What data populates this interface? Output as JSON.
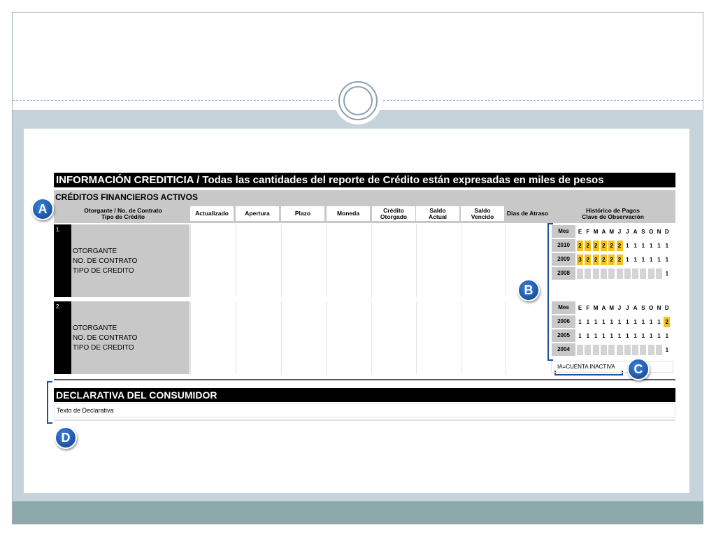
{
  "report": {
    "title": "INFORMACIÓN CREDITICIA / Todas las cantidades del reporte de Crédito están expresadas en miles de pesos",
    "section": "CRÉDITOS FINANCIEROS ACTIVOS",
    "headers": {
      "otorgante": "Otorgante / No. de Contrato\nTipo de Crédito",
      "actualizado": "Actualizado",
      "apertura": "Apertura",
      "plazo": "Plazo",
      "moneda": "Moneda",
      "credito_otorgado": "Crédito\nOtorgado",
      "saldo_actual": "Saldo\nActual",
      "saldo_vencido": "Saldo\nVencido",
      "dias_atraso": "Dias de Atraso",
      "historico": "Histórico de Pagos\nClave de Observación"
    },
    "records": [
      {
        "number": "1.",
        "lines": [
          "OTORGANTE",
          "NO. DE CONTRATO",
          "TIPO DE CREDITO"
        ],
        "history": [
          {
            "year": "Mes",
            "cells": [
              "E",
              "F",
              "M",
              "A",
              "M",
              "J",
              "J",
              "A",
              "S",
              "O",
              "N",
              "D"
            ],
            "header": true
          },
          {
            "year": "2010",
            "cells": [
              "2",
              "2",
              "2",
              "2",
              "2",
              "2",
              "1",
              "1",
              "1",
              "1",
              "1",
              "1"
            ],
            "highlight": [
              0,
              1,
              2,
              3,
              4,
              5
            ]
          },
          {
            "year": "2009",
            "cells": [
              "3",
              "2",
              "2",
              "2",
              "2",
              "2",
              "1",
              "1",
              "1",
              "1",
              "1",
              "1"
            ],
            "highlight": [
              0,
              1,
              2,
              3,
              4,
              5
            ]
          },
          {
            "year": "2008",
            "cells": [
              "",
              "",
              "",
              "",
              "",
              "",
              "",
              "",
              "",
              "",
              "",
              "1"
            ],
            "gray": [
              0,
              1,
              2,
              3,
              4,
              5,
              6,
              7,
              8,
              9,
              10
            ]
          }
        ]
      },
      {
        "number": "2.",
        "lines": [
          "OTORGANTE",
          "NO. DE CONTRATO",
          "TIPO DE CREDITO"
        ],
        "history": [
          {
            "year": "Mes",
            "cells": [
              "E",
              "F",
              "M",
              "A",
              "M",
              "J",
              "J",
              "A",
              "S",
              "O",
              "N",
              "D"
            ],
            "header": true
          },
          {
            "year": "2006",
            "cells": [
              "1",
              "1",
              "1",
              "1",
              "1",
              "1",
              "1",
              "1",
              "1",
              "1",
              "1",
              "2"
            ],
            "highlight": [
              11
            ]
          },
          {
            "year": "2005",
            "cells": [
              "1",
              "1",
              "1",
              "1",
              "1",
              "1",
              "1",
              "1",
              "1",
              "1",
              "1",
              "1"
            ]
          },
          {
            "year": "2004",
            "cells": [
              "",
              "",
              "",
              "",
              "",
              "",
              "",
              "",
              "",
              "",
              "",
              "1"
            ],
            "gray": [
              0,
              1,
              2,
              3,
              4,
              5,
              6,
              7,
              8,
              9,
              10
            ]
          }
        ]
      }
    ],
    "inactive_note": "IA=CUENTA INACTIVA",
    "declaration_title": "DECLARATIVA DEL CONSUMIDOR",
    "declaration_text": "Texto de Declarativa"
  },
  "badges": {
    "a": "A",
    "b": "B",
    "c": "C",
    "d": "D"
  },
  "colors": {
    "highlight": "#f2c318",
    "badge": "#1a5bb8",
    "bracket": "#1f4f9a",
    "band": "#c7d3da",
    "footer": "#8ea9ab"
  }
}
